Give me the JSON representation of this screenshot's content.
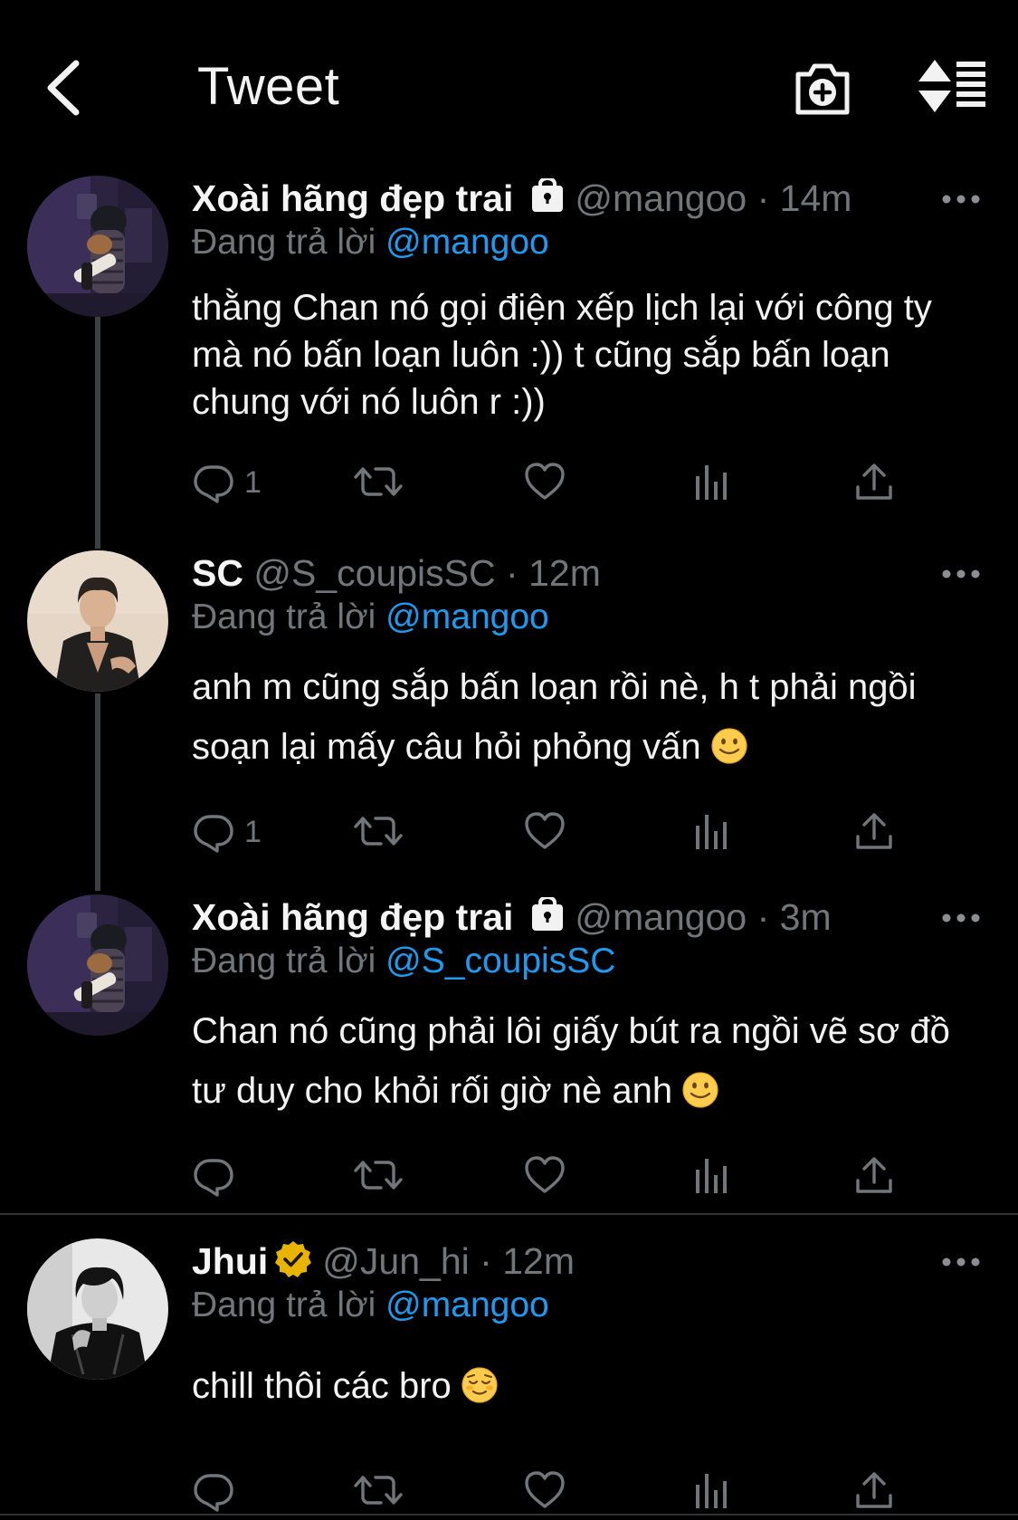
{
  "header": {
    "title": "Tweet",
    "back_icon": "chevron-left-icon",
    "camera_icon": "camera-plus-icon",
    "sort_icon": "sort-icon"
  },
  "reply_prefix": "Đang trả lời",
  "colors": {
    "background": "#000000",
    "text": "#e7e9ea",
    "secondary": "#71767b",
    "mention": "#1d9bf0",
    "divider": "#2f3336",
    "verified_badge": "#e8b400"
  },
  "tweets": [
    {
      "display_name": "Xoài hãng đẹp trai",
      "protected": true,
      "handle": "@mangoo",
      "time": "14m",
      "reply_to": "@mangoo",
      "text": "thằng Chan nó gọi điện xếp lịch lại với công ty mà nó bấn loạn luôn :)) t cũng sắp bấn loạn chung với nó luôn r :))",
      "reply_count": "1"
    },
    {
      "display_name": "SC",
      "protected": false,
      "handle": "@S_coupisSC",
      "time": "12m",
      "reply_to": "@mangoo",
      "text": "anh m cũng sắp bấn loạn rồi nè, h t phải ngồi soạn lại mấy câu hỏi phỏng vấn",
      "emoji": "slightly-smiling-face",
      "reply_count": "1"
    },
    {
      "display_name": "Xoài hãng đẹp trai",
      "protected": true,
      "handle": "@mangoo",
      "time": "3m",
      "reply_to": "@S_coupisSC",
      "text": "Chan nó cũng phải lôi giấy bút ra ngồi vẽ sơ đồ tư duy cho khỏi rối giờ nè anh",
      "emoji": "slightly-smiling-face",
      "reply_count": ""
    },
    {
      "display_name": "Jhui",
      "verified": true,
      "handle": "@Jun_hi",
      "time": "12m",
      "reply_to": "@mangoo",
      "text": "chill thôi các bro",
      "emoji": "relieved-face",
      "reply_count": ""
    }
  ],
  "separator": "·"
}
